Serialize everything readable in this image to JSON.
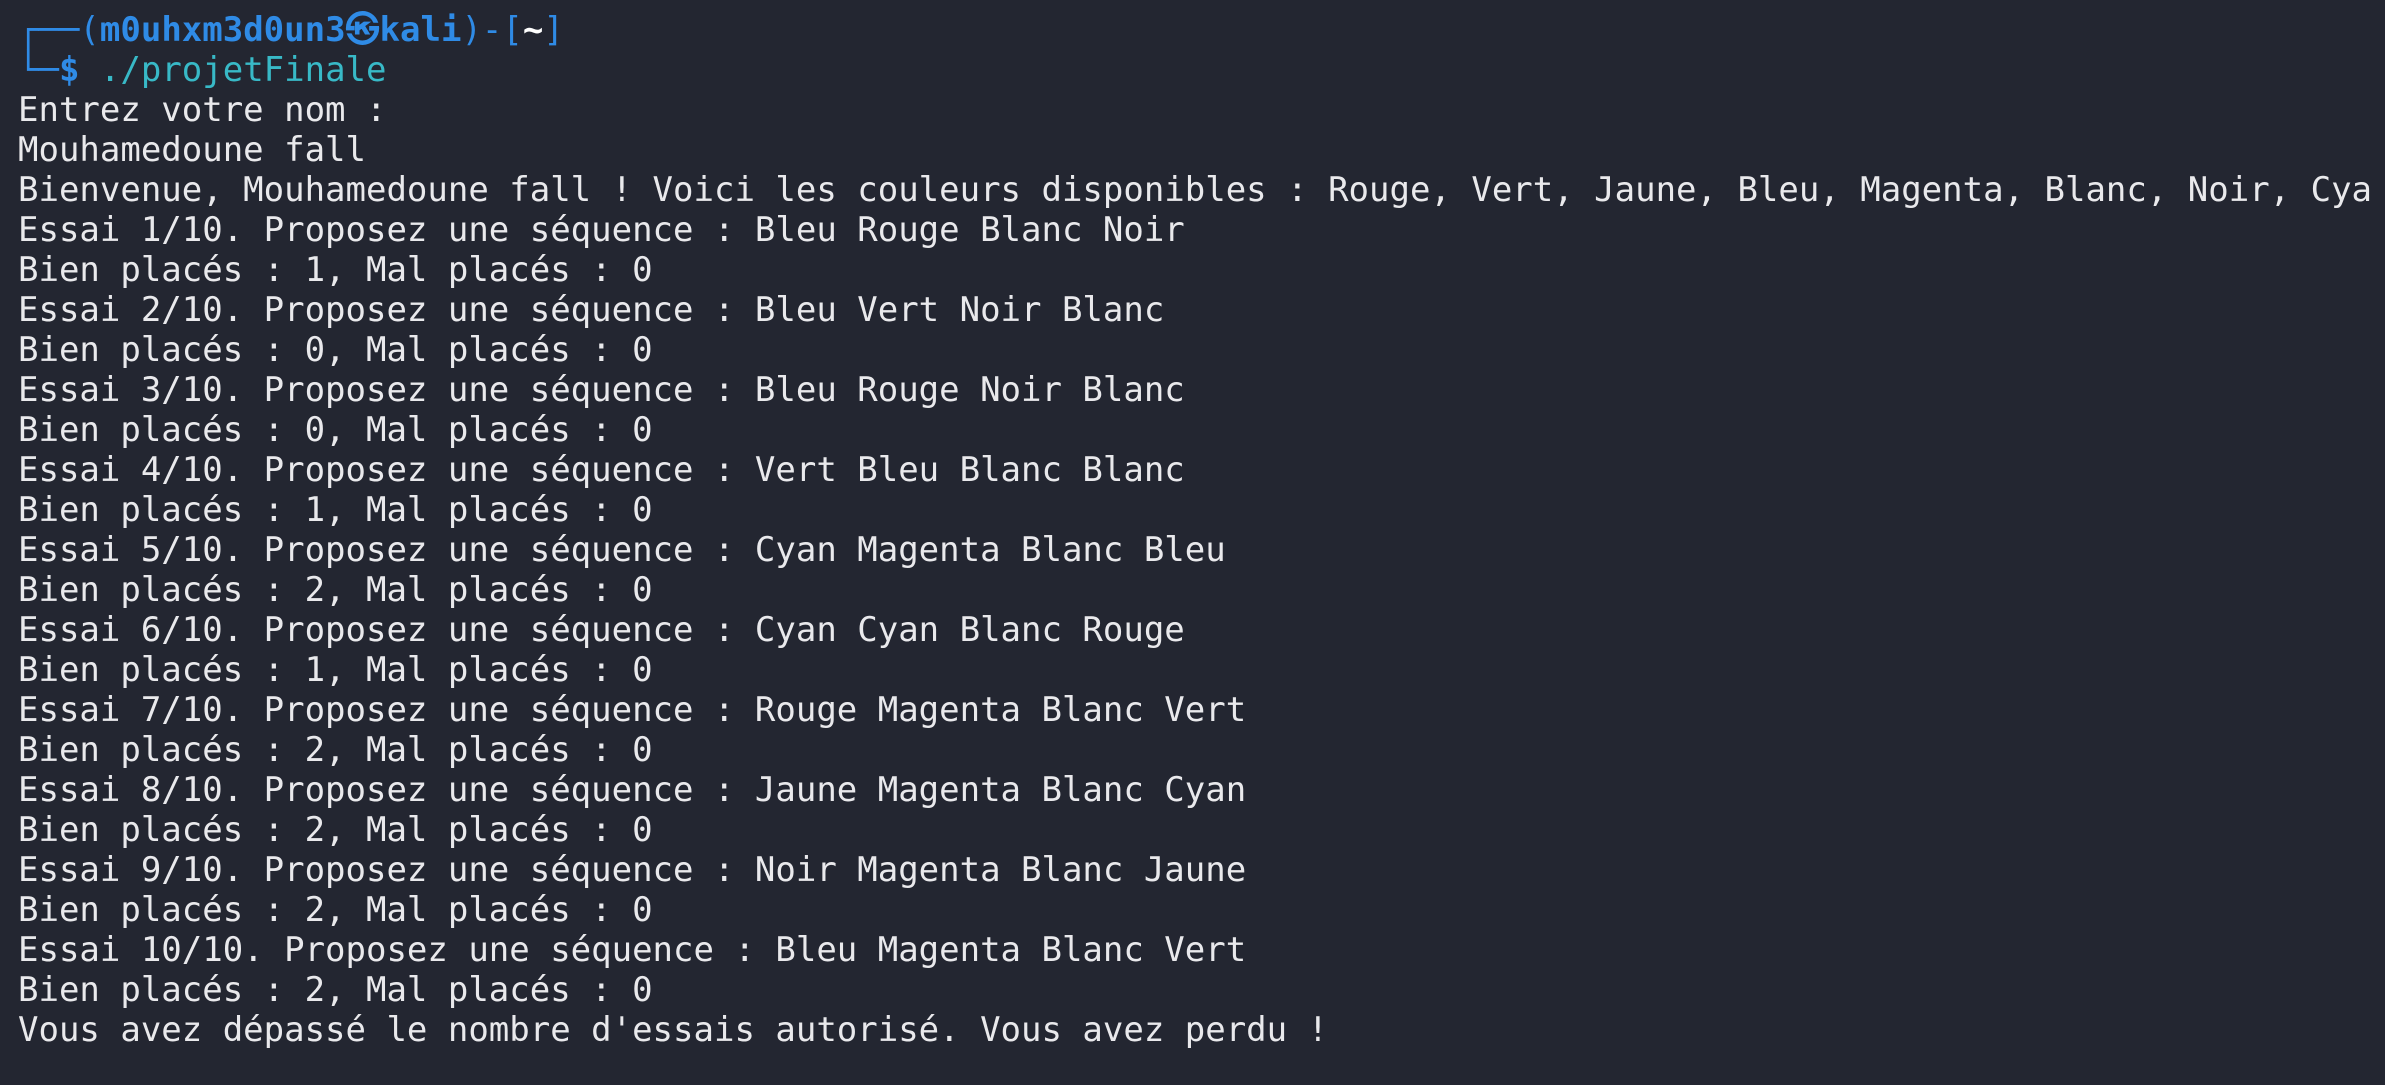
{
  "prompt": {
    "corner_top": "┌──",
    "paren_open": "(",
    "user": "m0uhxm3d0un3",
    "skull": "㉿",
    "host": "kali",
    "paren_close": ")-[",
    "cwd": "~",
    "bracket_close": "]",
    "corner_bottom": "└─",
    "dollar": "$",
    "command": "./projetFinale"
  },
  "output": [
    "Entrez votre nom :",
    "Mouhamedoune fall",
    "Bienvenue, Mouhamedoune fall ! Voici les couleurs disponibles : Rouge, Vert, Jaune, Bleu, Magenta, Blanc, Noir, Cyan",
    "Essai 1/10. Proposez une séquence : Bleu Rouge Blanc Noir",
    "Bien placés : 1, Mal placés : 0",
    "Essai 2/10. Proposez une séquence : Bleu Vert Noir Blanc",
    "Bien placés : 0, Mal placés : 0",
    "Essai 3/10. Proposez une séquence : Bleu Rouge Noir Blanc",
    "Bien placés : 0, Mal placés : 0",
    "Essai 4/10. Proposez une séquence : Vert Bleu Blanc Blanc",
    "Bien placés : 1, Mal placés : 0",
    "Essai 5/10. Proposez une séquence : Cyan Magenta Blanc Bleu",
    "Bien placés : 2, Mal placés : 0",
    "Essai 6/10. Proposez une séquence : Cyan Cyan Blanc Rouge",
    "Bien placés : 1, Mal placés : 0",
    "Essai 7/10. Proposez une séquence : Rouge Magenta Blanc Vert",
    "Bien placés : 2, Mal placés : 0",
    "Essai 8/10. Proposez une séquence : Jaune Magenta Blanc Cyan",
    "Bien placés : 2, Mal placés : 0",
    "Essai 9/10. Proposez une séquence : Noir Magenta Blanc Jaune",
    "Bien placés : 2, Mal placés : 0",
    "Essai 10/10. Proposez une séquence : Bleu Magenta Blanc Vert",
    "Bien placés : 2, Mal placés : 0",
    "Vous avez dépassé le nombre d'essais autorisé. Vous avez perdu !"
  ],
  "colors": {
    "background": "#232631",
    "prompt_blue": "#2f8be6",
    "command_cyan": "#38b9c7",
    "text": "#e9e9ec"
  }
}
